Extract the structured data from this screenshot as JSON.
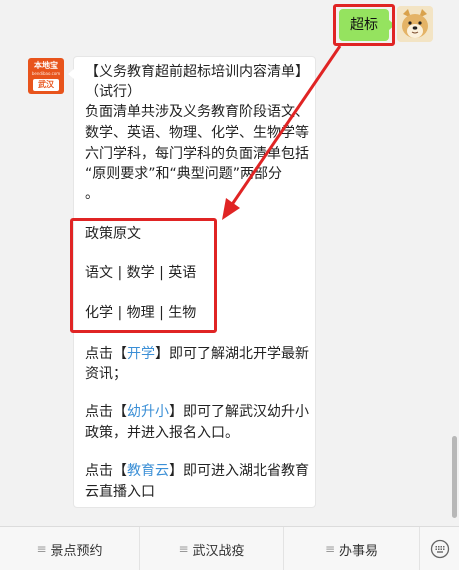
{
  "user_message": {
    "text": "超标"
  },
  "bot": {
    "logo_top": "本地宝",
    "logo_mid": "bendibao.com",
    "logo_city": "武汉"
  },
  "bot_message": {
    "lines": [
      "【义务教育超前超标培训内容清单】",
      "（试行）",
      "负面清单共涉及义务教育阶段语文、",
      "数学、英语、物理、化学、生物学等",
      "六门学科，每门学科的负面清单包括",
      "“原则要求”和“典型问题”两部分",
      "。"
    ],
    "policy_title": "政策原文",
    "policy_row1": "语文 | 数学 | 英语",
    "policy_row2": "化学 | 物理 | 生物",
    "tip1": {
      "prefix": "点击【",
      "link": "开学",
      "suffix": "】即可了解湖北开学最新",
      "line2": "资讯；"
    },
    "tip2": {
      "prefix": "点击【",
      "link": "幼升小",
      "suffix": "】即可了解武汉幼升小",
      "line2": "政策，并进入报名入口。"
    },
    "tip3": {
      "prefix": "点击【",
      "link": "教育云",
      "suffix": "】即可进入湖北省教育",
      "line2": "云直播入口"
    }
  },
  "menu": {
    "items": [
      "景点预约",
      "武汉战疫",
      "办事易"
    ],
    "hamburger": "≡",
    "keyboard_icon": "keyboard-icon"
  },
  "colors": {
    "highlight": "#e02424",
    "user_bubble": "#95e35f",
    "link": "#3b8fd6",
    "logo": "#e8541c"
  }
}
